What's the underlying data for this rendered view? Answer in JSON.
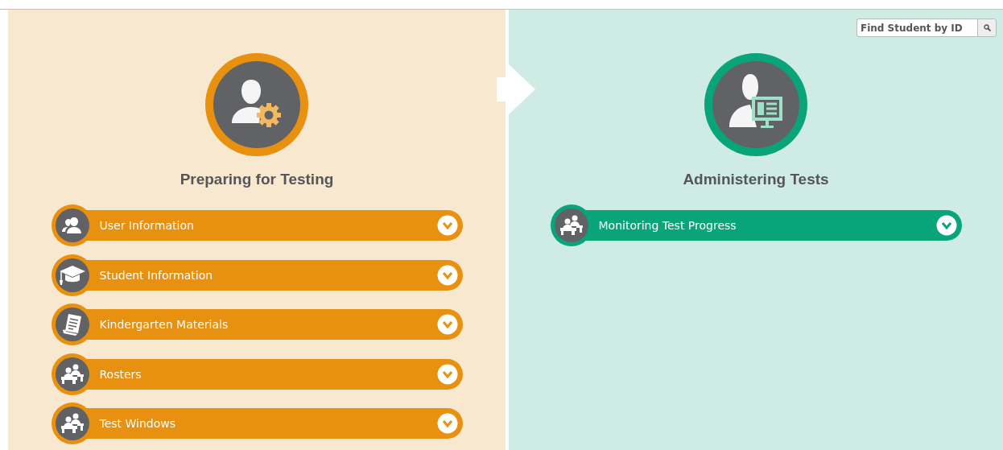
{
  "search": {
    "placeholder": "Find Student by ID"
  },
  "sections": [
    {
      "title": "Preparing for Testing",
      "color": "#e8900f",
      "kind": "setup",
      "items": [
        {
          "label": "User Information",
          "kind": "users",
          "expanded": false
        },
        {
          "label": "Student Information",
          "kind": "graduate",
          "expanded": false
        },
        {
          "label": "Kindergarten Materials",
          "kind": "document",
          "expanded": false
        },
        {
          "label": "Rosters",
          "kind": "classroom",
          "expanded": false
        },
        {
          "label": "Test Windows",
          "kind": "classroom",
          "expanded": false
        }
      ]
    },
    {
      "title": "Administering Tests",
      "color": "#0aa47a",
      "kind": "monitor",
      "items": [
        {
          "label": "Monitoring Test Progress",
          "kind": "classroom",
          "expanded": false
        }
      ]
    }
  ]
}
